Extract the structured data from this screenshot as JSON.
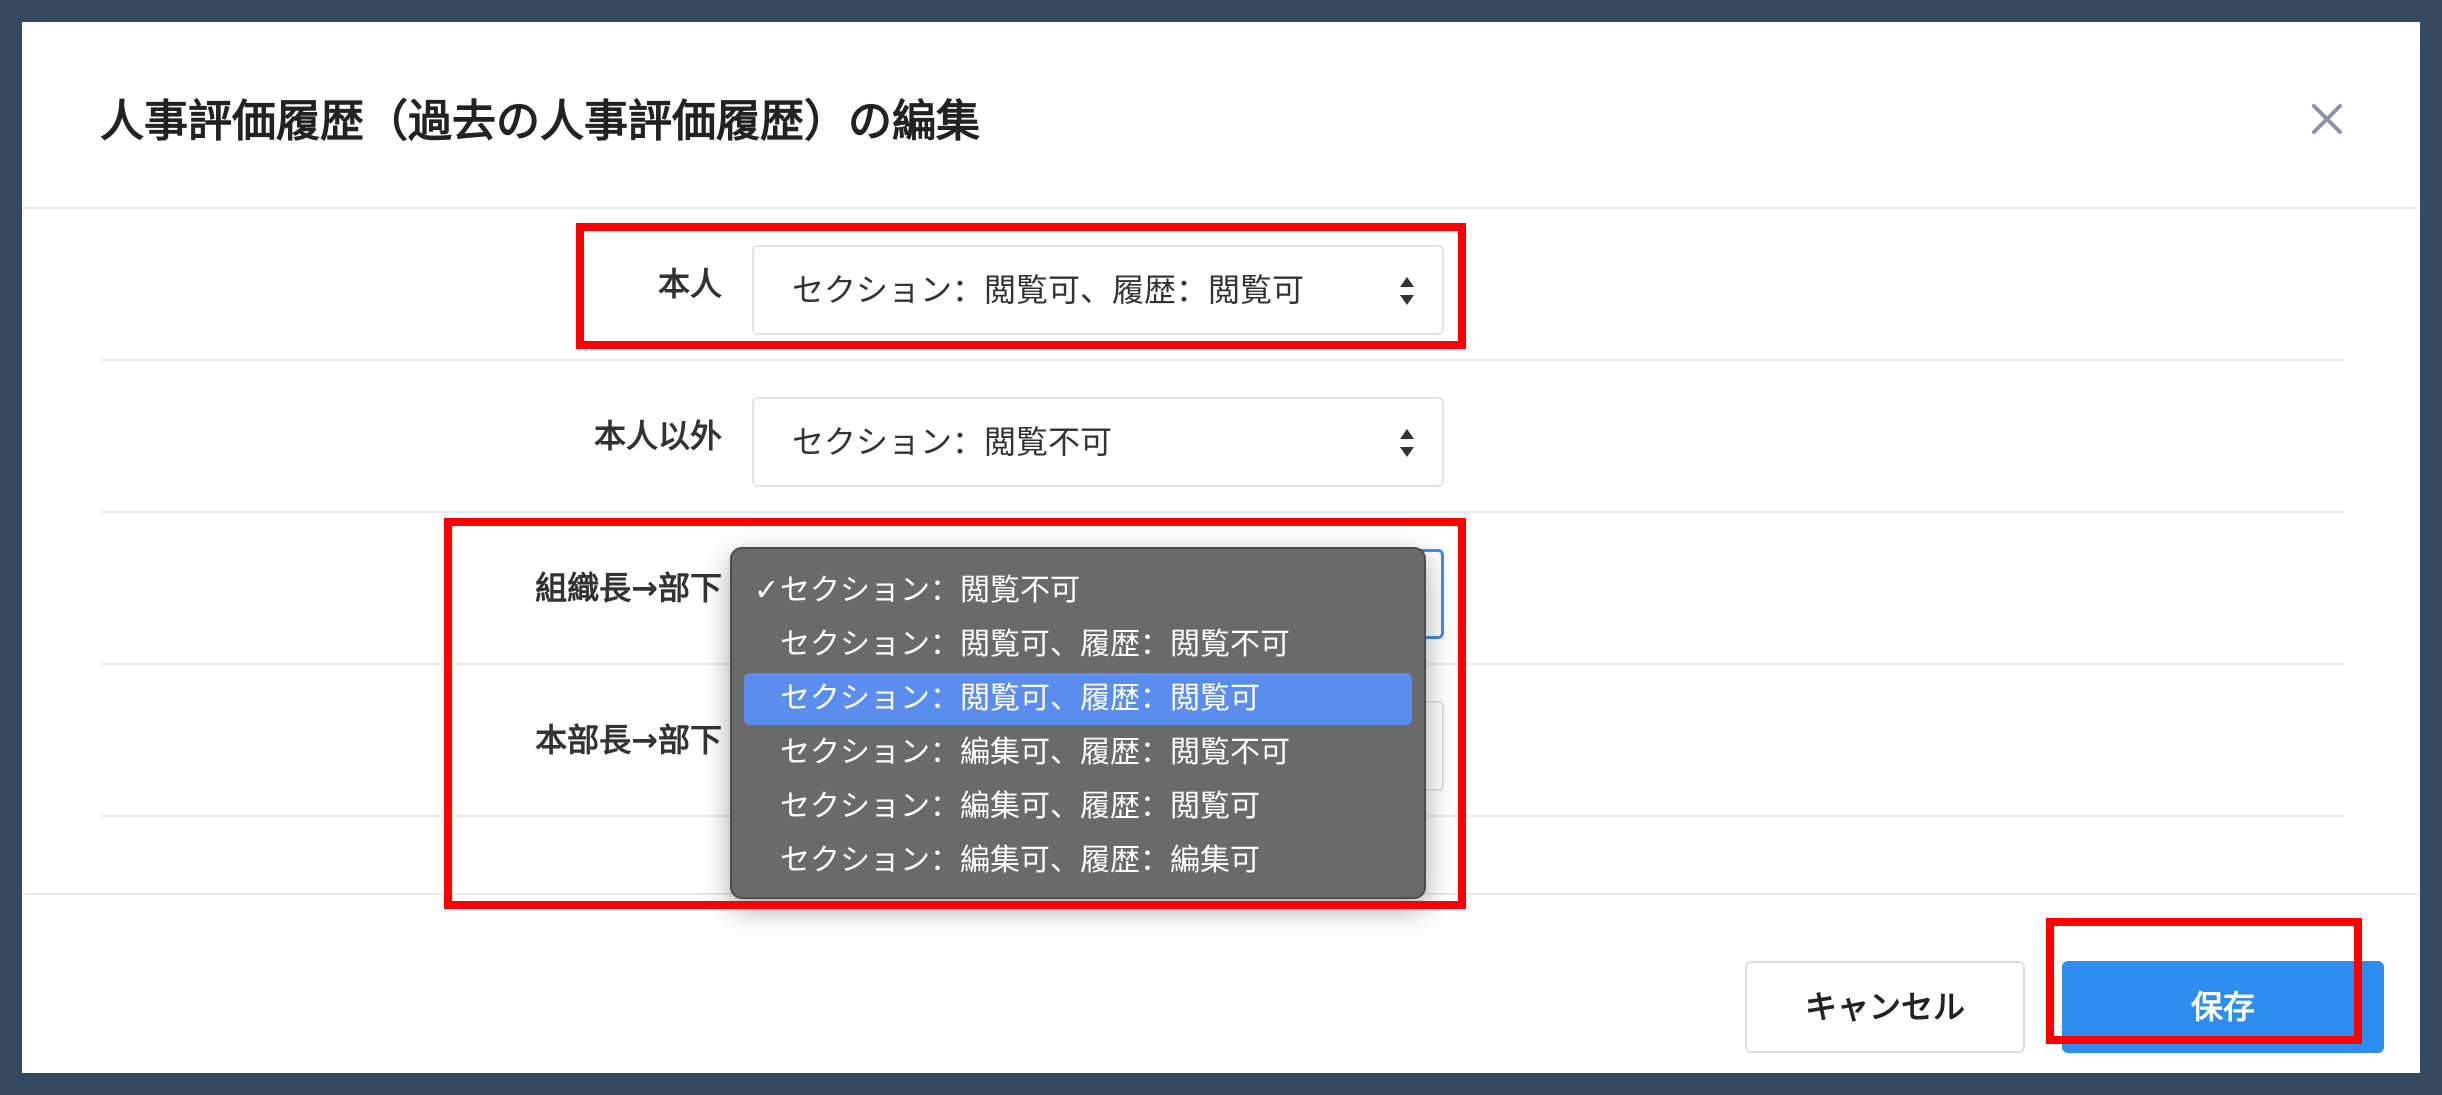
{
  "modal": {
    "title": "人事評価履歴（過去の人事評価履歴）の編集",
    "close_icon": "close-icon"
  },
  "rows": [
    {
      "label": "本人",
      "value": "セクション：閲覧可、履歴：閲覧可"
    },
    {
      "label": "本人以外",
      "value": "セクション：閲覧不可"
    },
    {
      "label": "組織長→部下",
      "value": ""
    },
    {
      "label": "本部長→部下",
      "value": ""
    }
  ],
  "dropdown": {
    "options": [
      {
        "label": "セクション：閲覧不可",
        "checked": true
      },
      {
        "label": "セクション：閲覧可、履歴：閲覧不可"
      },
      {
        "label": "セクション：閲覧可、履歴：閲覧可",
        "active": true
      },
      {
        "label": "セクション：編集可、履歴：閲覧不可"
      },
      {
        "label": "セクション：編集可、履歴：閲覧可"
      },
      {
        "label": "セクション：編集可、履歴：編集可"
      }
    ],
    "check_mark": "✓"
  },
  "footer": {
    "cancel_label": "キャンセル",
    "save_label": "保存"
  },
  "colors": {
    "primary": "#2d8cf0",
    "highlight": "#ff0000",
    "dropdown_bg": "#6a6a6a",
    "dropdown_active": "#5b8def"
  }
}
